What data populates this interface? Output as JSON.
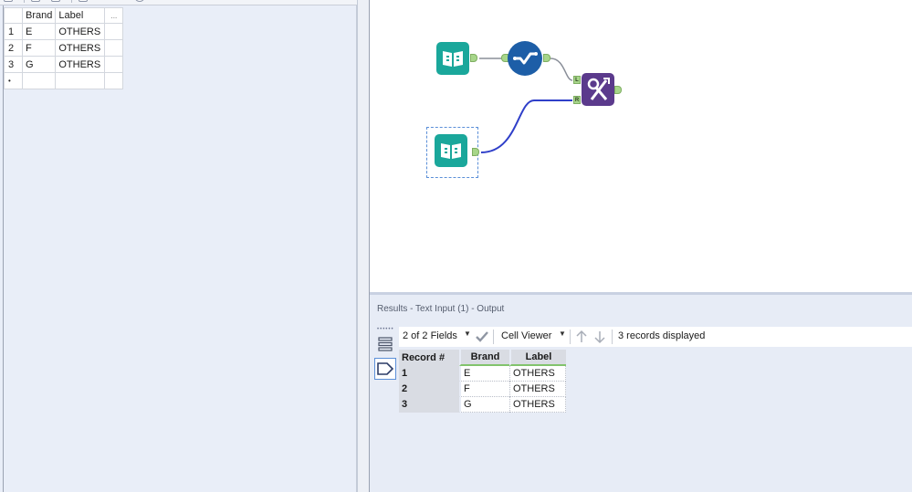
{
  "config_table": {
    "headers": [
      "",
      "Brand",
      "Label",
      "..."
    ],
    "rows": [
      {
        "num": "1",
        "brand": "E",
        "label": "OTHERS"
      },
      {
        "num": "2",
        "brand": "F",
        "label": "OTHERS"
      },
      {
        "num": "3",
        "brand": "G",
        "label": "OTHERS"
      },
      {
        "num": "•",
        "brand": "",
        "label": ""
      }
    ]
  },
  "canvas": {
    "join_anchor_left": "L",
    "join_anchor_right": "R"
  },
  "results": {
    "title": "Results - Text Input (1) - Output",
    "fields_label": "2 of 2 Fields",
    "viewer_label": "Cell Viewer",
    "records_label": "3 records displayed",
    "columns": [
      "Record #",
      "Brand",
      "Label"
    ],
    "rows": [
      {
        "num": "1",
        "brand": "E",
        "label": "OTHERS"
      },
      {
        "num": "2",
        "brand": "F",
        "label": "OTHERS"
      },
      {
        "num": "3",
        "brand": "G",
        "label": "OTHERS"
      }
    ]
  },
  "colors": {
    "input_tool": "#1aa79b",
    "select_tool": "#1d5ea7",
    "join_tool": "#5b3a8c",
    "anchor": "#a7d68a",
    "connection_selected": "#2f3fc9",
    "connection": "#8a8f99"
  },
  "icons": [
    "book-icon",
    "select-check-icon",
    "join-icon",
    "list-view-icon",
    "tag-icon",
    "checkmark-icon",
    "up-arrow-icon",
    "down-arrow-icon"
  ]
}
